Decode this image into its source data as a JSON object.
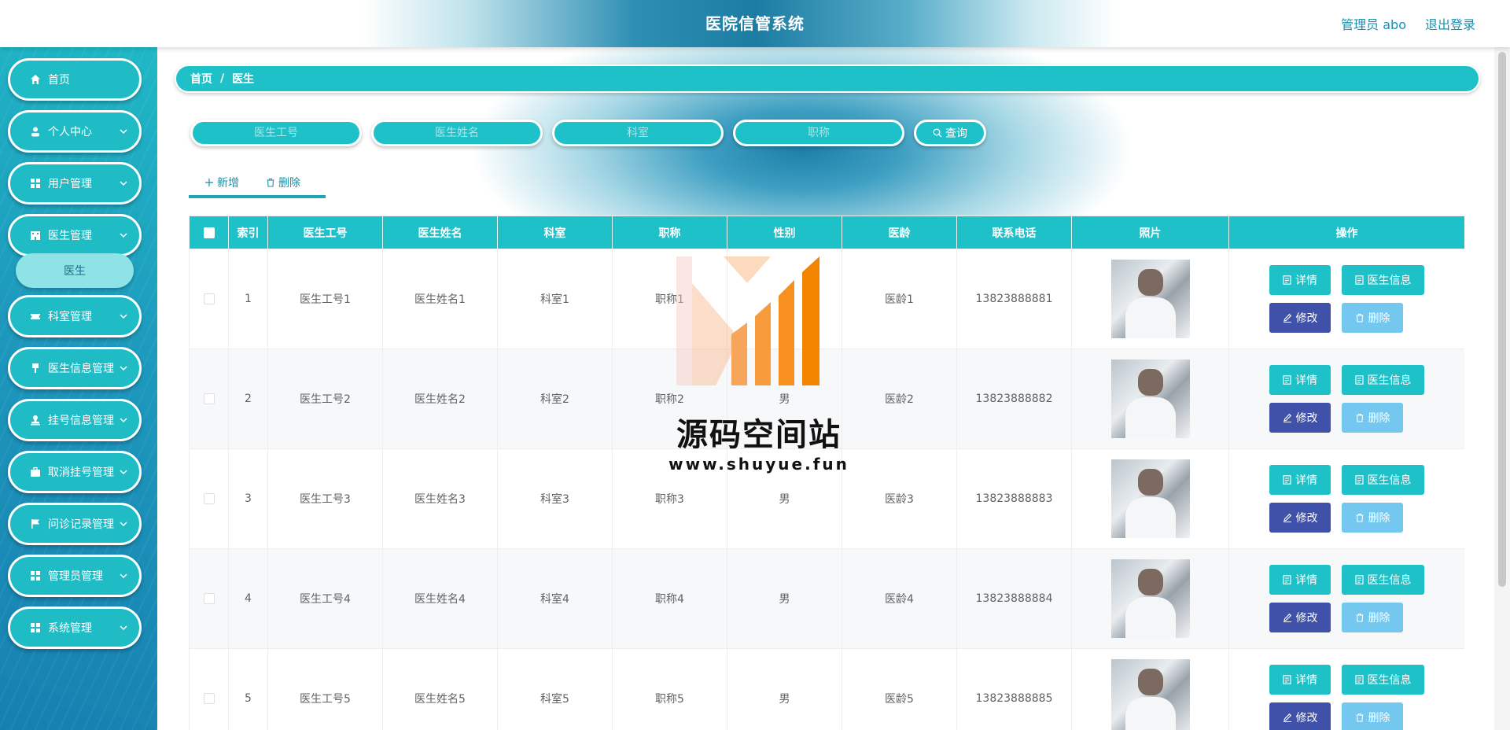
{
  "header": {
    "title": "医院信管系统",
    "user_label": "管理员 abo",
    "logout_label": "退出登录"
  },
  "sidebar": {
    "items": [
      {
        "label": "首页",
        "icon": "home-icon"
      },
      {
        "label": "个人中心",
        "icon": "user-icon"
      },
      {
        "label": "用户管理",
        "icon": "grid-icon"
      },
      {
        "label": "医生管理",
        "icon": "building-icon"
      },
      {
        "label": "科室管理",
        "icon": "ticket-icon"
      },
      {
        "label": "医生信息管理",
        "icon": "brush-icon"
      },
      {
        "label": "挂号信息管理",
        "icon": "stamp-icon"
      },
      {
        "label": "取消挂号管理",
        "icon": "briefcase-icon"
      },
      {
        "label": "问诊记录管理",
        "icon": "flag-icon"
      },
      {
        "label": "管理员管理",
        "icon": "grid-icon"
      },
      {
        "label": "系统管理",
        "icon": "grid-icon"
      }
    ],
    "submenu": {
      "label": "医生"
    }
  },
  "breadcrumb": {
    "home": "首页",
    "separator": "/",
    "current": "医生"
  },
  "search": {
    "doctor_id_placeholder": "医生工号",
    "doctor_name_placeholder": "医生姓名",
    "department_placeholder": "科室",
    "title_placeholder": "职称",
    "button_label": "查询"
  },
  "actions": {
    "add_label": "新增",
    "delete_label": "删除"
  },
  "table": {
    "columns": [
      "索引",
      "医生工号",
      "医生姓名",
      "科室",
      "职称",
      "性别",
      "医龄",
      "联系电话",
      "照片",
      "操作"
    ],
    "rows": [
      {
        "index": "1",
        "doctor_id": "医生工号1",
        "name": "医生姓名1",
        "dept": "科室1",
        "title": "职称1",
        "gender": "男",
        "seniority": "医龄1",
        "phone": "13823888881"
      },
      {
        "index": "2",
        "doctor_id": "医生工号2",
        "name": "医生姓名2",
        "dept": "科室2",
        "title": "职称2",
        "gender": "男",
        "seniority": "医龄2",
        "phone": "13823888882"
      },
      {
        "index": "3",
        "doctor_id": "医生工号3",
        "name": "医生姓名3",
        "dept": "科室3",
        "title": "职称3",
        "gender": "男",
        "seniority": "医龄3",
        "phone": "13823888883"
      },
      {
        "index": "4",
        "doctor_id": "医生工号4",
        "name": "医生姓名4",
        "dept": "科室4",
        "title": "职称4",
        "gender": "男",
        "seniority": "医龄4",
        "phone": "13823888884"
      },
      {
        "index": "5",
        "doctor_id": "医生工号5",
        "name": "医生姓名5",
        "dept": "科室5",
        "title": "职称5",
        "gender": "男",
        "seniority": "医龄5",
        "phone": "13823888885"
      }
    ],
    "ops": {
      "detail": "详情",
      "info": "医生信息",
      "edit": "修改",
      "delete": "删除"
    }
  },
  "watermark": {
    "title": "源码空间站",
    "url": "www.shuyue.fun"
  },
  "colors": {
    "primary": "#1fc1c8",
    "edit": "#3f51a8",
    "delete": "#74c7ef",
    "header_text": "#1b8fb0"
  }
}
